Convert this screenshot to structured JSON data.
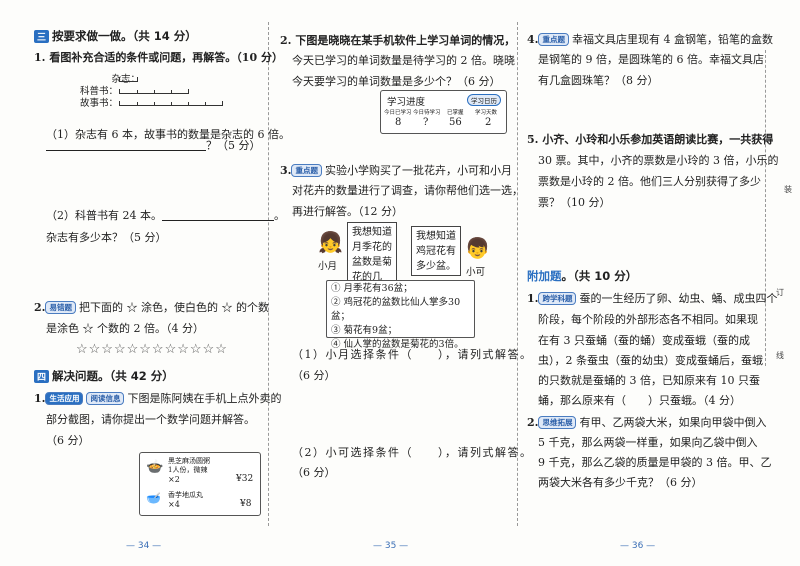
{
  "left": {
    "section3": {
      "badge": "三",
      "title": "按要求做一做。（共 14 分）"
    },
    "q1": {
      "text": "1. 看图补充合适的条件或问题，再解答。（10 分）",
      "diagram_labels": [
        "杂志：",
        "科普书：",
        "故事书："
      ],
      "diagram_units": [
        1,
        4,
        6
      ],
      "part1_line1": "（1）杂志有 6 本，故事书的数量是杂志的 6 倍。",
      "part1_tail": "？（5 分）",
      "part2_line1": "（2）科普书有 24 本。",
      "part2_end": "。",
      "part2_line2": "杂志有多少本？（5 分）"
    },
    "q2": {
      "num": "2.",
      "tag": "易错题",
      "line1": "把下面的 ☆ 涂色，使白色的 ☆ 的个数",
      "line2": "是涂色 ☆ 个数的 2 倍。（4 分）",
      "stars": "☆☆☆☆☆☆☆☆☆☆☆☆"
    },
    "section4": {
      "badge": "四",
      "title": "解决问题。（共 42 分）"
    },
    "q4_1": {
      "num": "1.",
      "tags": [
        "生活应用",
        "阅读信息"
      ],
      "line1": "下图是陈阿姨在手机上点外卖的",
      "line2": "部分截图，请你提出一个数学问题并解答。",
      "line3": "（6 分）",
      "order": [
        {
          "name": "黑芝麻汤圆粥",
          "spec": "1人份，微辣",
          "qty": "×2",
          "price": "¥32"
        },
        {
          "name": "香芋地瓜丸",
          "spec": "",
          "qty": "×4",
          "price": "¥8"
        }
      ]
    },
    "page_number": "— 34 —"
  },
  "middle": {
    "q2": {
      "line1": "2. 下图是晓晓在某手机软件上学习单词的情况，",
      "line2": "今天已学习的单词数量是待学习的 2 倍。晓晓",
      "line3": "今天要学习的单词数量是多少个？（6 分）",
      "progress": {
        "title": "学习进度",
        "button": "学习日历",
        "headers": [
          "今日已学习",
          "今日待学习",
          "已掌握",
          "学习天数"
        ],
        "values": [
          "8",
          "?",
          "56",
          "2"
        ]
      }
    },
    "q3": {
      "num": "3.",
      "tag": "重点题",
      "line1": "实验小学购买了一批花卉，小可和小月",
      "line2": "对花卉的数量进行了调查，请你帮他们选一选，",
      "line3": "再进行解答。（12 分）",
      "girl_name": "小月",
      "girl_speech": "我想知道月季花的盆数是菊花的几倍。",
      "boy_name": "小可",
      "boy_speech": "我想知道鸡冠花有多少盆。",
      "conditions": [
        "① 月季花有36盆；",
        "② 鸡冠花的盆数比仙人掌多30盆；",
        "③ 菊花有9盆；",
        "④ 仙人掌的盆数是菊花的3倍。"
      ],
      "part1": "（1）小月选择条件（　　），请列式解答。",
      "part1_score": "（6 分）",
      "part2": "（2）小可选择条件（　　），请列式解答。",
      "part2_score": "（6 分）"
    },
    "page_number": "— 35 —"
  },
  "right": {
    "q4": {
      "num": "4.",
      "tag": "重点题",
      "line1": "幸福文具店里现有 4 盒钢笔，铅笔的盒数",
      "line2": "是钢笔的 9 倍，是圆珠笔的 6 倍。幸福文具店",
      "line3": "有几盒圆珠笔？（8 分）"
    },
    "q5": {
      "line1": "5. 小齐、小玲和小乐参加英语朗读比赛，一共获得",
      "line2": "30 票。其中，小齐的票数是小玲的 3 倍，小乐的",
      "line3": "票数是小玲的 2 倍。他们三人分别获得了多少",
      "line4": "票？（10 分）"
    },
    "extra": {
      "title": "附加题",
      "suffix": "。（共 10 分）"
    },
    "e1": {
      "num": "1.",
      "tag": "跨学科题",
      "lines": [
        "蚕的一生经历了卵、幼虫、蛹、成虫四个",
        "阶段，每个阶段的外部形态各不相同。如果现",
        "在有 3 只蚕蛹（蚕的蛹）变成蚕蛾（蚕的成",
        "虫），2 条蚕虫（蚕的幼虫）变成蚕蛹后，蚕蛾",
        "的只数就是蚕蛹的 3 倍，已知原来有 10 只蚕",
        "蛹，那么原来有（　　）只蚕蛾。（4 分）"
      ]
    },
    "e2": {
      "num": "2.",
      "tag": "思维拓展",
      "lines": [
        "有甲、乙两袋大米，如果向甲袋中倒入",
        "5 千克，那么两袋一样重，如果向乙袋中倒入",
        "9 千克，那么乙袋的质量是甲袋的 3 倍。甲、乙",
        "两袋大米各有多少千克？（6 分）"
      ]
    },
    "page_number": "— 36 —",
    "binding_marks": [
      "装",
      "订",
      "线"
    ]
  },
  "colors": {
    "accent": "#2a6fc1",
    "text": "#222222"
  }
}
